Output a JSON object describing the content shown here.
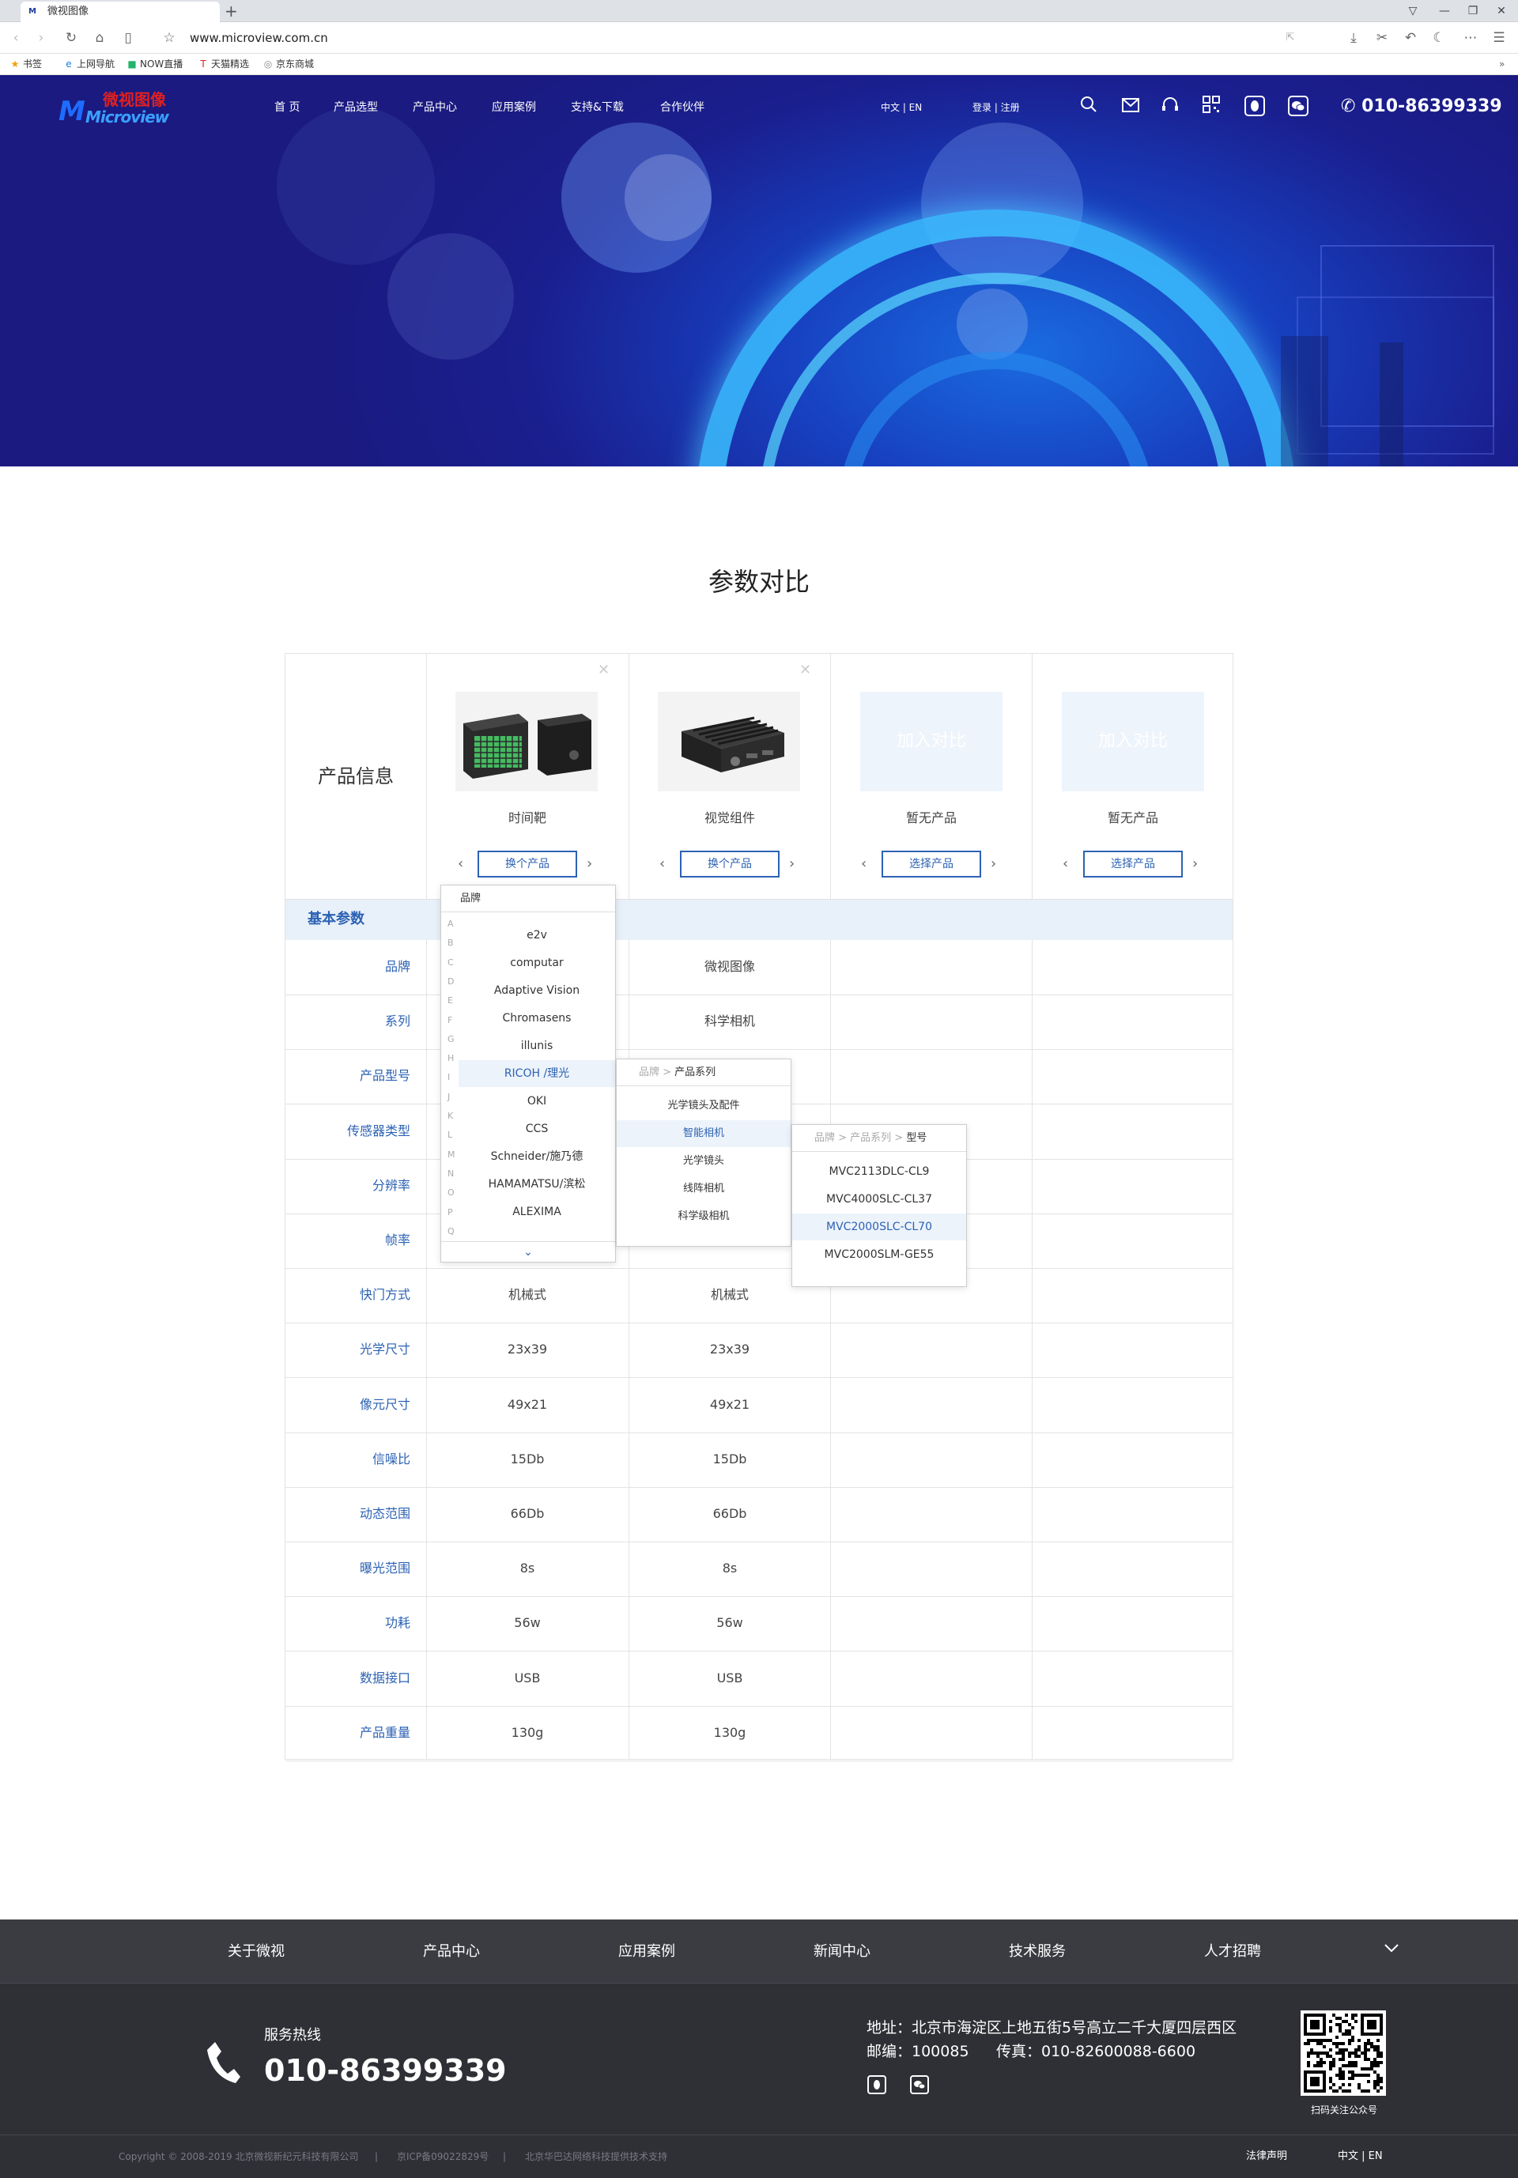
{
  "browser": {
    "tab_title": "微视图像",
    "favicon": "M",
    "new_tab": "+",
    "url": "www.microview.com.cn",
    "bookmarks": [
      "书签",
      "上网导航",
      "NOW直播",
      "天猫精选",
      "京东商城"
    ]
  },
  "header": {
    "logo_cn": "微视图像",
    "logo_en": "Microview",
    "nav": [
      "首 页",
      "产品选型",
      "产品中心",
      "应用案例",
      "支持&下载",
      "合作伙伴"
    ],
    "lang": "中文 | EN",
    "login": "登录 | 注册",
    "phone": "010-86399339"
  },
  "page_title": "参数对比",
  "compare": {
    "product_info_label": "产品信息",
    "products": [
      {
        "name": "时间靶",
        "button": "换个产品"
      },
      {
        "name": "视觉组件",
        "button": "换个产品"
      },
      {
        "name": "暂无产品",
        "button": "选择产品",
        "placeholder": "加入对比"
      },
      {
        "name": "暂无产品",
        "button": "选择产品",
        "placeholder": "加入对比"
      }
    ],
    "basic_params_label": "基本参数",
    "rows": [
      {
        "label": "品牌",
        "values": [
          "",
          "微视图像",
          "",
          ""
        ]
      },
      {
        "label": "系列",
        "values": [
          "",
          "科学相机",
          "",
          ""
        ]
      },
      {
        "label": "产品型号",
        "values": [
          "",
          "",
          "",
          ""
        ]
      },
      {
        "label": "传感器类型",
        "values": [
          "",
          "",
          "",
          ""
        ]
      },
      {
        "label": "分辨率",
        "values": [
          "",
          "",
          "",
          ""
        ]
      },
      {
        "label": "帧率",
        "values": [
          "",
          "",
          "",
          ""
        ]
      },
      {
        "label": "快门方式",
        "values": [
          "机械式",
          "机械式",
          "",
          ""
        ]
      },
      {
        "label": "光学尺寸",
        "values": [
          "23x39",
          "23x39",
          "",
          ""
        ]
      },
      {
        "label": "像元尺寸",
        "values": [
          "49x21",
          "49x21",
          "",
          ""
        ]
      },
      {
        "label": "信噪比",
        "values": [
          "15Db",
          "15Db",
          "",
          ""
        ]
      },
      {
        "label": "动态范围",
        "values": [
          "66Db",
          "66Db",
          "",
          ""
        ]
      },
      {
        "label": "曝光范围",
        "values": [
          "8s",
          "8s",
          "",
          ""
        ]
      },
      {
        "label": "功耗",
        "values": [
          "56w",
          "56w",
          "",
          ""
        ]
      },
      {
        "label": "数据接口",
        "values": [
          "USB",
          "USB",
          "",
          ""
        ]
      },
      {
        "label": "产品重量",
        "values": [
          "130g",
          "130g",
          "",
          ""
        ]
      }
    ]
  },
  "brand_dropdown": {
    "header": "品牌",
    "letters": [
      "A",
      "B",
      "C",
      "D",
      "E",
      "F",
      "G",
      "H",
      "I",
      "J",
      "K",
      "L",
      "M",
      "N",
      "O",
      "P",
      "Q"
    ],
    "items": [
      "e2v",
      "computar",
      "Adaptive Vision",
      "Chromasens",
      "illunis",
      "RICOH /理光",
      "OKI",
      "CCS",
      "Schneider/施乃德",
      "HAMAMATSU/滨松",
      "ALEXIMA"
    ],
    "selected": "RICOH /理光"
  },
  "series_dropdown": {
    "header_crumb": "品牌 > ",
    "header_current": "产品系列",
    "items": [
      "光学镜头及配件",
      "智能相机",
      "光学镜头",
      "线阵相机",
      "科学级相机"
    ],
    "selected": "智能相机"
  },
  "model_dropdown": {
    "header_crumb": "品牌 > 产品系列 > ",
    "header_current": "型号",
    "items": [
      "MVC2113DLC-CL9",
      "MVC4000SLC-CL37",
      "MVC2000SLC-CL70",
      "MVC2000SLM-GE55"
    ],
    "selected": "MVC2000SLC-CL70"
  },
  "footer": {
    "nav": [
      "关于微视",
      "产品中心",
      "应用案例",
      "新闻中心",
      "技术服务",
      "人才招聘"
    ],
    "hotline_label": "服务热线",
    "hotline": "010-86399339",
    "address": "地址：北京市海淀区上地五街5号高立二千大厦四层西区",
    "postcode": "邮编：100085",
    "fax": "传真：010-82600088-6600",
    "qr_caption": "扫码关注公众号",
    "copyright": "Copyright © 2008-2019 北京微视新纪元科技有限公司",
    "sep": "|",
    "icp": "京ICP备09022829号",
    "tech": "北京华巴达网络科技提供技术支持",
    "legal": "法律声明",
    "lang": "中文 | EN"
  }
}
